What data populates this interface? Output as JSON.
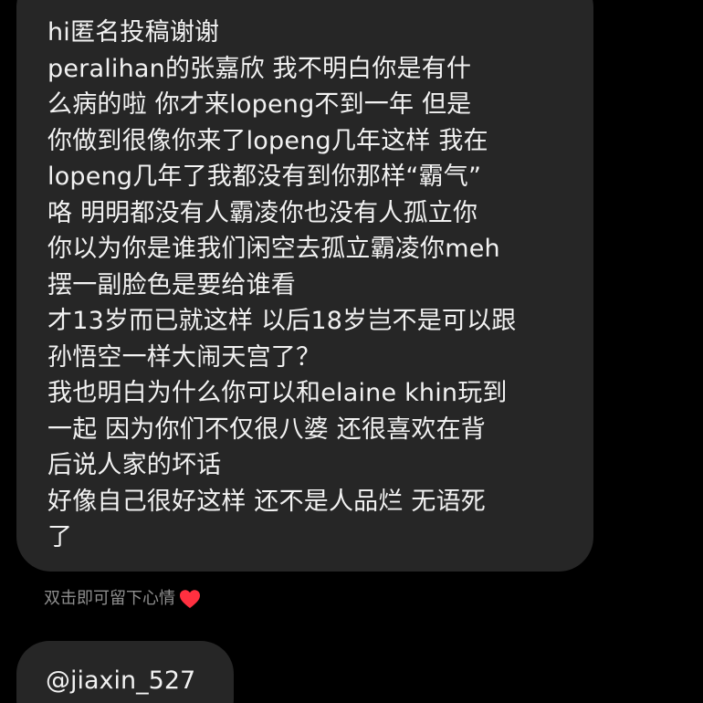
{
  "message": {
    "lines": [
      "hi匿名投稿谢谢",
      "peralihan的张嘉欣 我不明白你是有什",
      "么病的啦 你才来lopeng不到一年 但是",
      "你做到很像你来了lopeng几年这样 我在",
      "lopeng几年了我都没有到你那样“霸气”",
      "咯 明明都没有人霸凌你也没有人孤立你",
      "你以为你是谁我们闲空去孤立霸凌你meh",
      "摆一副脸色是要给谁看",
      "才13岁而已就这样 以后18岁岂不是可以跟",
      "孙悟空一样大闹天宫了？",
      "我也明白为什么你可以和elaine khin玩到",
      "一起 因为你们不仅很八婆 还很喜欢在背",
      "后说人家的坏话",
      "好像自己很好这样 还不是人品烂 无语死",
      "了"
    ]
  },
  "reaction_hint": {
    "text": "双击即可留下心情",
    "icon": "heart-icon",
    "icon_color": "#ff3040"
  },
  "mention": {
    "text": "@jiaxin_527"
  },
  "colors": {
    "background": "#000000",
    "bubble": "#262626",
    "text": "#f2f2f2",
    "hint_text": "#8e8e8e"
  }
}
